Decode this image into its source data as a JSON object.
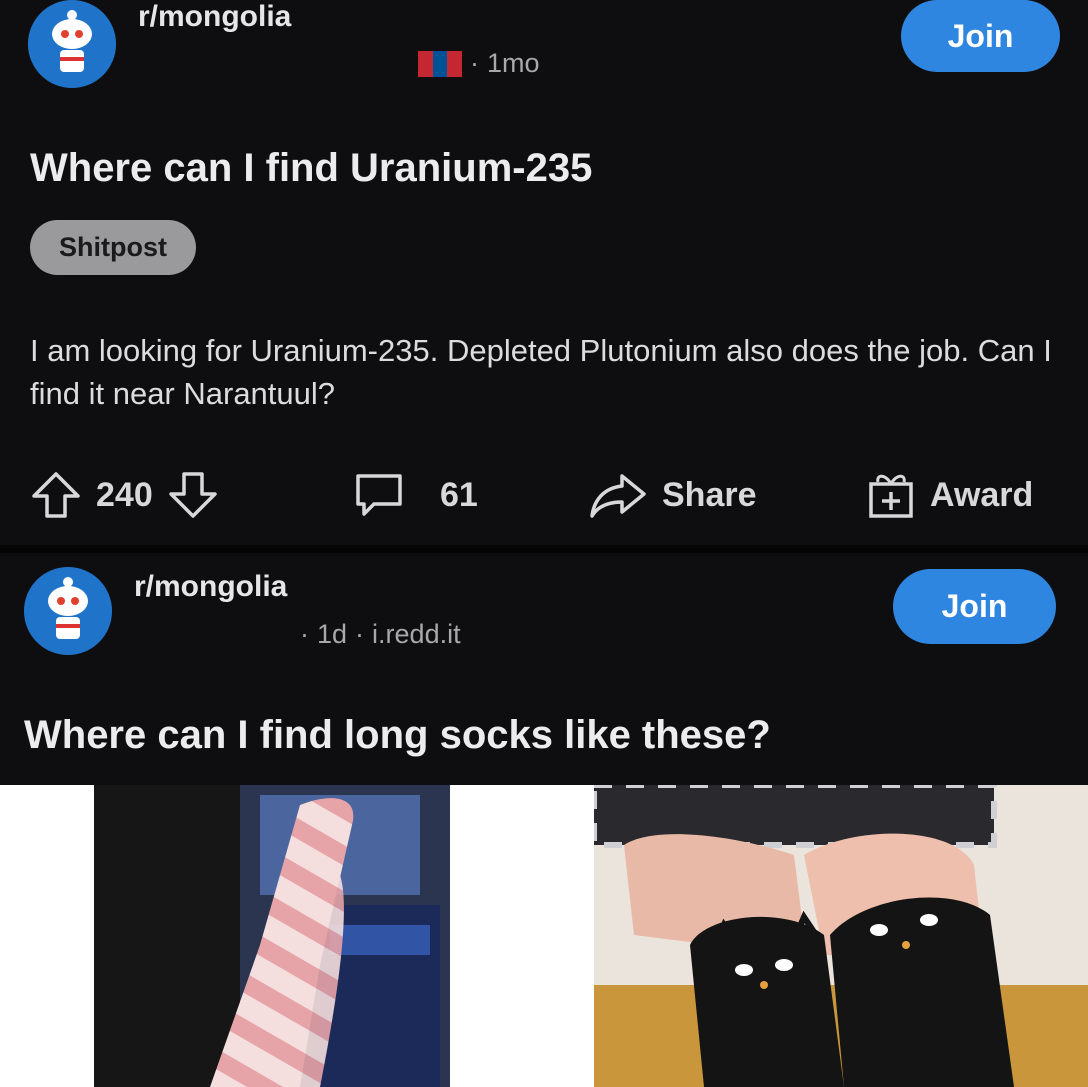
{
  "post1": {
    "subreddit": "r/mongolia",
    "age": "1mo",
    "join_label": "Join",
    "title": "Where can I find Uranium-235",
    "flair": "Shitpost",
    "body": "I am looking for Uranium-235. Depleted Plutonium also does the job. Can I find it near Narantuul?",
    "upvotes": "240",
    "comments": "61",
    "share_label": "Share",
    "award_label": "Award"
  },
  "post2": {
    "subreddit": "r/mongolia",
    "age": "1d",
    "domain": "i.redd.it",
    "join_label": "Join",
    "title": "Where can I find long socks like these?"
  },
  "colors": {
    "background": "#0e0e10",
    "join_button": "#2f86e0",
    "flair": "#9a9a9c",
    "avatar": "#1f74c9"
  },
  "icons": [
    "snoo-avatar-icon",
    "mongolia-flag-icon",
    "upvote-arrow-icon",
    "downvote-arrow-icon",
    "comment-bubble-icon",
    "share-arrow-icon",
    "award-gift-icon"
  ]
}
